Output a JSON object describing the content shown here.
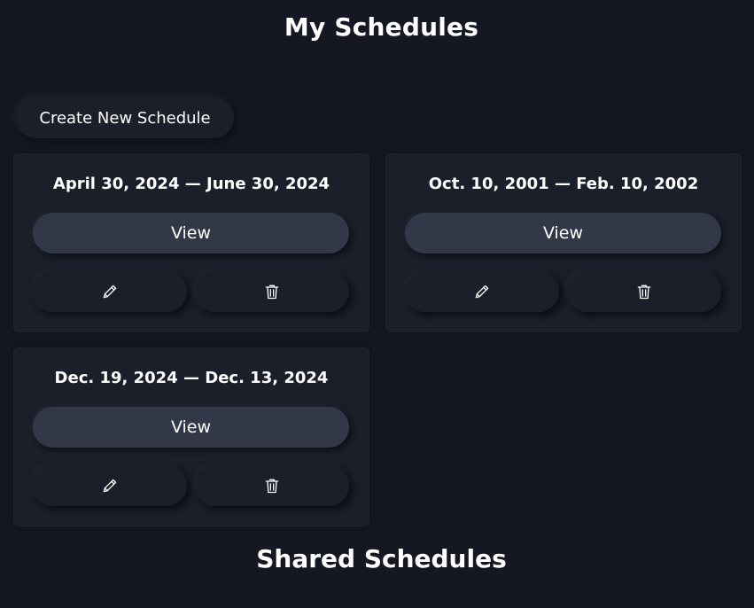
{
  "header": {
    "title": "My Schedules"
  },
  "toolbar": {
    "create_label": "Create New Schedule"
  },
  "schedules": [
    {
      "range": "April 30, 2024 — June 30, 2024",
      "view_label": "View"
    },
    {
      "range": "Oct. 10, 2001 — Feb. 10, 2002",
      "view_label": "View"
    },
    {
      "range": "Dec. 19, 2024 — Dec. 13, 2024",
      "view_label": "View"
    }
  ],
  "shared": {
    "title": "Shared Schedules"
  },
  "icons": {
    "edit": "pencil-icon",
    "delete": "trash-icon"
  },
  "colors": {
    "background": "#151823",
    "card": "#1b1f2a",
    "view_button": "#323847",
    "text": "#ffffff"
  }
}
